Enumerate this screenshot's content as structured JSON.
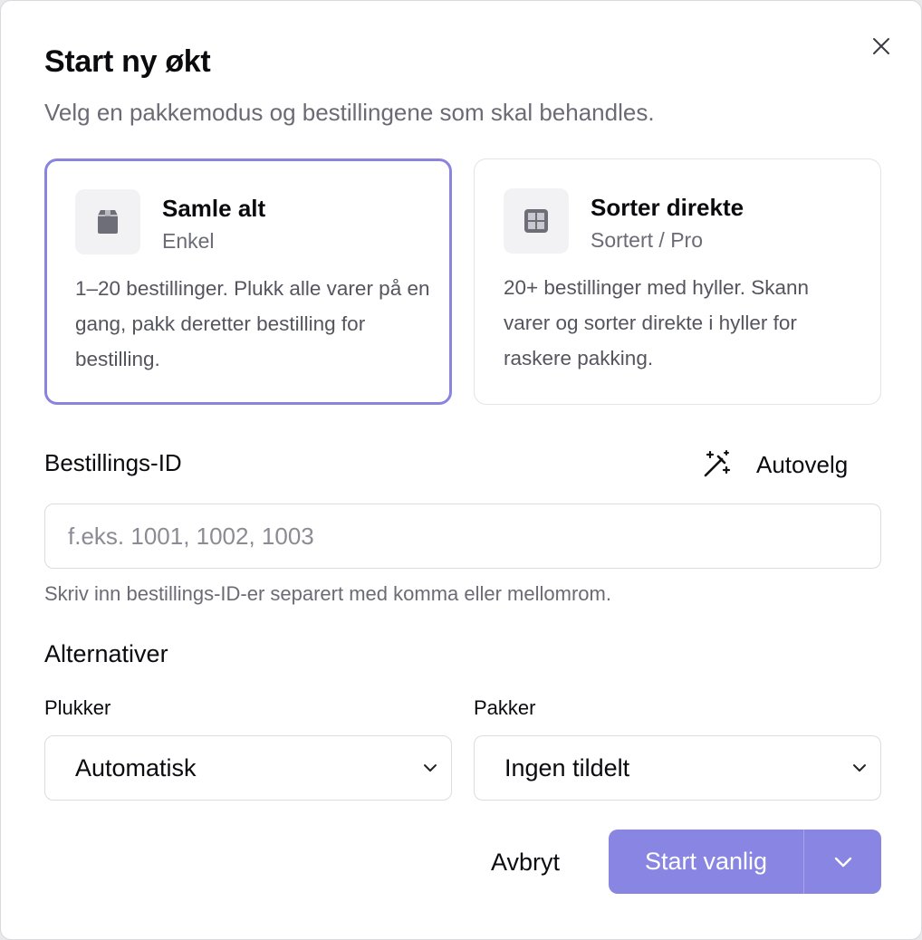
{
  "dialog": {
    "title": "Start ny økt",
    "subtitle": "Velg en pakkemodus og bestillingene som skal behandles."
  },
  "modes": [
    {
      "name": "Samle alt",
      "tag": "Enkel",
      "description": "1–20 bestillinger. Plukk alle varer på en gang, pakk deretter bestilling for bestilling.",
      "icon": "box-icon",
      "selected": true
    },
    {
      "name": "Sorter direkte",
      "tag": "Sortert / Pro",
      "description": "20+ bestillinger med hyller. Skann varer og sorter direkte i hyller for raskere pakking.",
      "icon": "grid-icon",
      "selected": false
    }
  ],
  "order_ids": {
    "label": "Bestillings-ID",
    "autoselect_label": "Autovelg",
    "autoselect_icon": "magic-wand-icon",
    "value": "",
    "placeholder": "f.eks. 1001, 1002, 1003",
    "hint": "Skriv inn bestillings-ID-er separert med komma eller mellomrom."
  },
  "options": {
    "title": "Alternativer",
    "picker": {
      "label": "Plukker",
      "value": "Automatisk"
    },
    "packer": {
      "label": "Pakker",
      "value": "Ingen tildelt"
    }
  },
  "actions": {
    "cancel_label": "Avbryt",
    "start_label": "Start vanlig"
  },
  "colors": {
    "accent": "#8985e2",
    "selected_border": "#8a84df",
    "muted_text": "#6b6b76"
  }
}
